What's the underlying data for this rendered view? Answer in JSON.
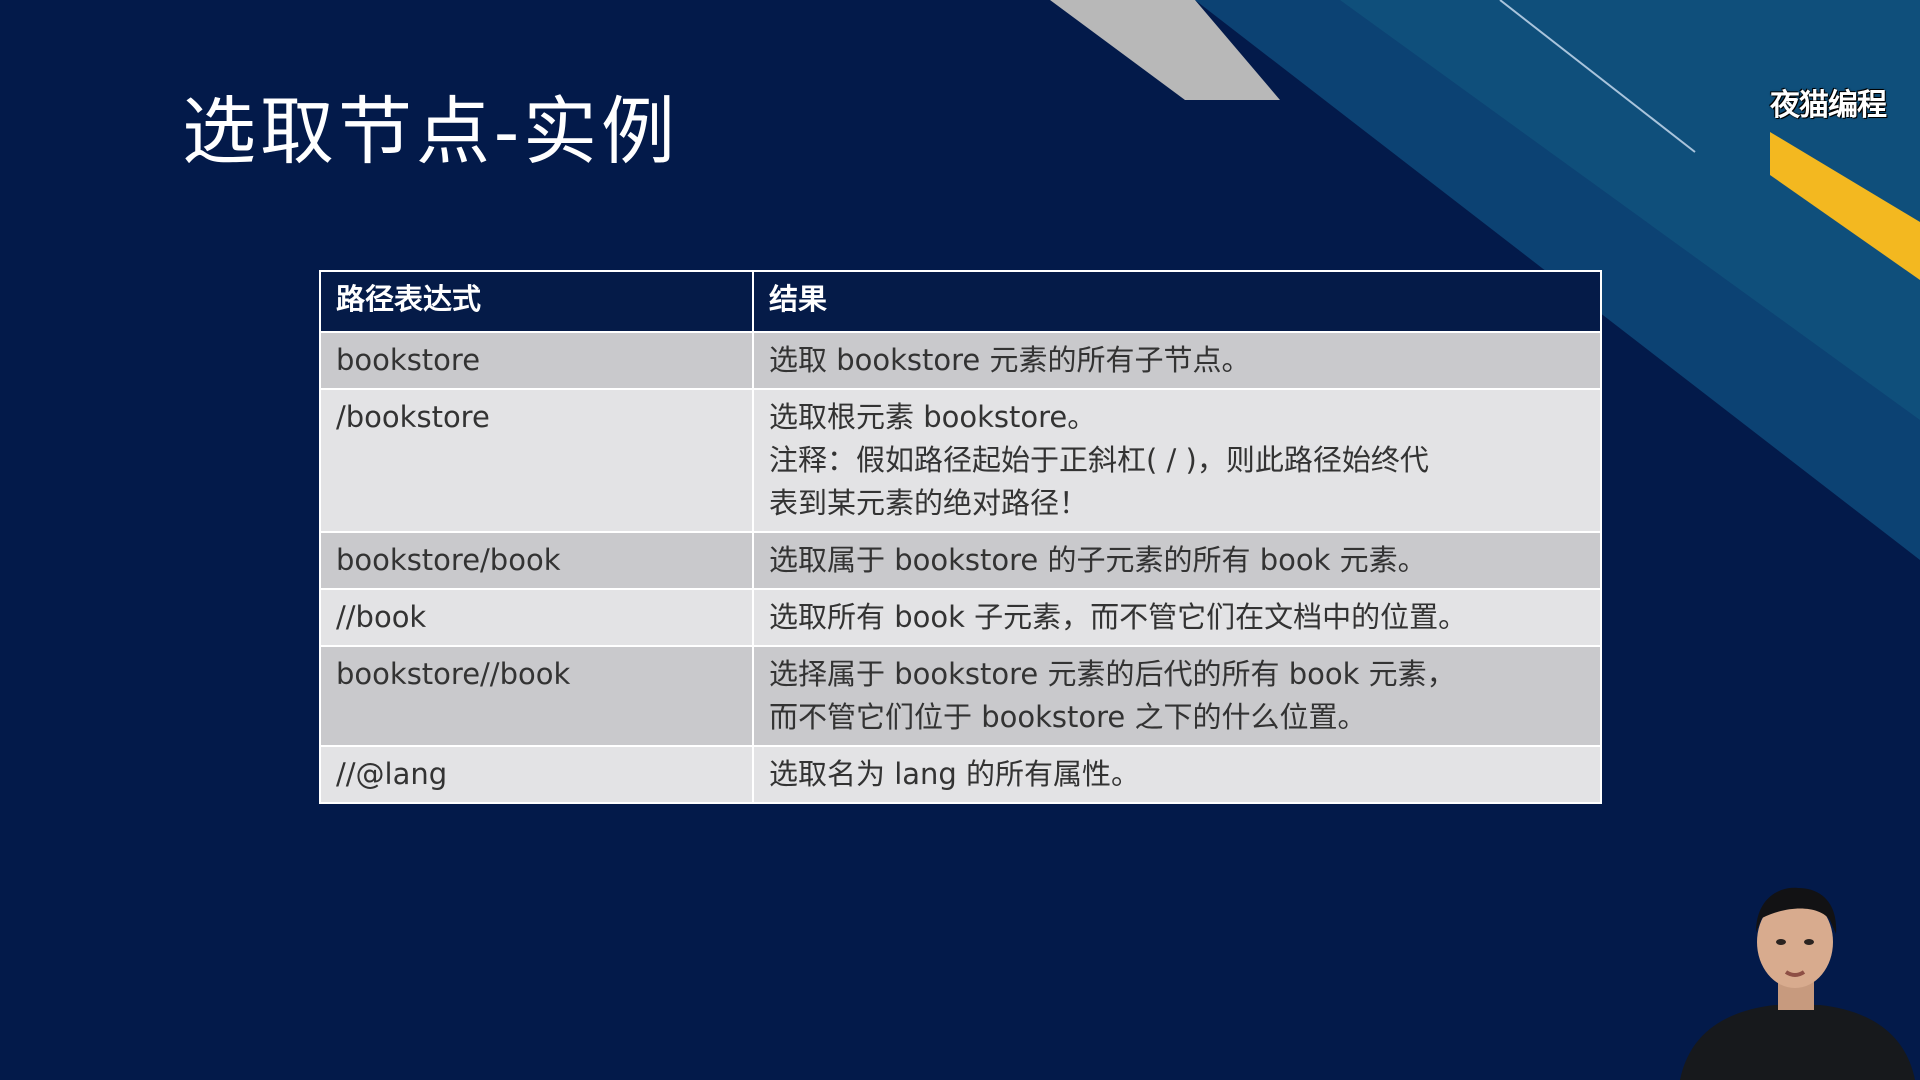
{
  "slide": {
    "title": "选取节点-实例",
    "watermark": "夜猫编程"
  },
  "table": {
    "headers": [
      "路径表达式",
      "结果"
    ],
    "rows": [
      {
        "path": "bookstore",
        "result": [
          "选取 bookstore 元素的所有子节点。"
        ]
      },
      {
        "path": "/bookstore",
        "result": [
          "选取根元素 bookstore。",
          "注释：假如路径起始于正斜杠( / )，则此路径始终代",
          "表到某元素的绝对路径！"
        ]
      },
      {
        "path": "bookstore/book",
        "result": [
          "选取属于 bookstore 的子元素的所有 book 元素。"
        ]
      },
      {
        "path": "//book",
        "result": [
          "选取所有 book 子元素，而不管它们在文档中的位置。"
        ]
      },
      {
        "path": "bookstore//book",
        "result": [
          "选择属于 bookstore 元素的后代的所有 book 元素，",
          "而不管它们位于 bookstore 之下的什么位置。"
        ]
      },
      {
        "path": "//@lang",
        "result": [
          "选取名为 lang 的所有属性。"
        ]
      }
    ]
  }
}
